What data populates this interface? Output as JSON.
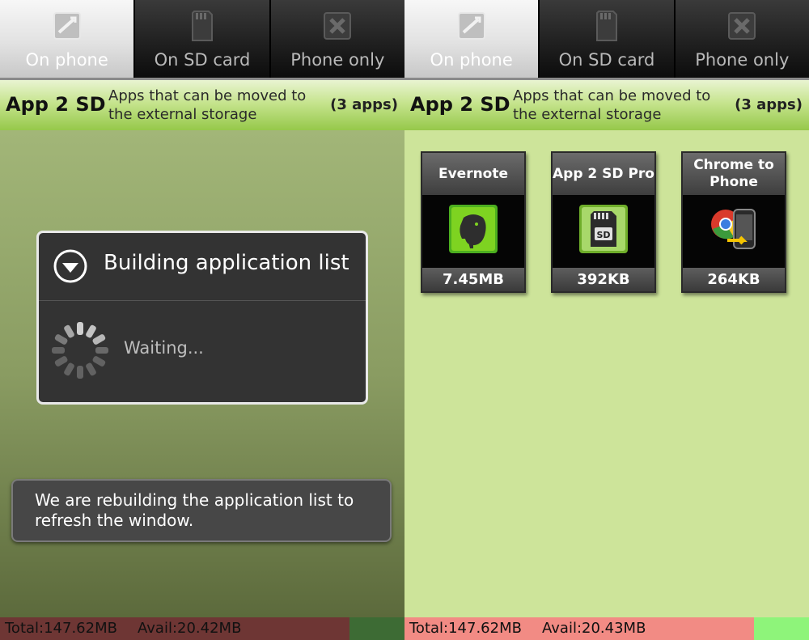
{
  "screens": [
    {
      "tabs": [
        {
          "label": "On phone",
          "icon": "phone-apps-icon",
          "selected": true
        },
        {
          "label": "On SD card",
          "icon": "sd-card-icon",
          "selected": false
        },
        {
          "label": "Phone only",
          "icon": "phone-only-icon",
          "selected": false
        }
      ],
      "header": {
        "title": "App 2 SD",
        "description": "Apps that can be moved to the external storage",
        "count": "(3 apps)"
      },
      "dialog": {
        "icon": "chevron-down-circle-icon",
        "title": "Building application list",
        "message": "Waiting..."
      },
      "toast": {
        "text": "We are rebuilding the application list to refresh the window."
      },
      "status": {
        "total": "Total:147.62MB",
        "avail": "Avail:20.42MB",
        "colors": {
          "used": "#6e3634",
          "free": "#3d6b34"
        }
      }
    },
    {
      "tabs": [
        {
          "label": "On phone",
          "icon": "phone-apps-icon",
          "selected": true
        },
        {
          "label": "On SD card",
          "icon": "sd-card-icon",
          "selected": false
        },
        {
          "label": "Phone only",
          "icon": "phone-only-icon",
          "selected": false
        }
      ],
      "header": {
        "title": "App 2 SD",
        "description": "Apps that can be moved to the external storage",
        "count": "(3 apps)"
      },
      "apps": [
        {
          "name": "Evernote",
          "size": "7.45MB",
          "icon": "evernote-elephant-icon"
        },
        {
          "name": "App 2 SD Pro",
          "size": "392KB",
          "icon": "sd-card-app-icon"
        },
        {
          "name": "Chrome to Phone",
          "size": "264KB",
          "icon": "chrome-to-phone-icon"
        }
      ],
      "status": {
        "total": "Total:147.62MB",
        "avail": "Avail:20.43MB",
        "colors": {
          "used": "#f28b84",
          "free": "#8ef47a"
        }
      }
    }
  ],
  "colors": {
    "header_green": "#96c84a",
    "content_green": "#cde49a",
    "dialog_bg": "#333333"
  }
}
